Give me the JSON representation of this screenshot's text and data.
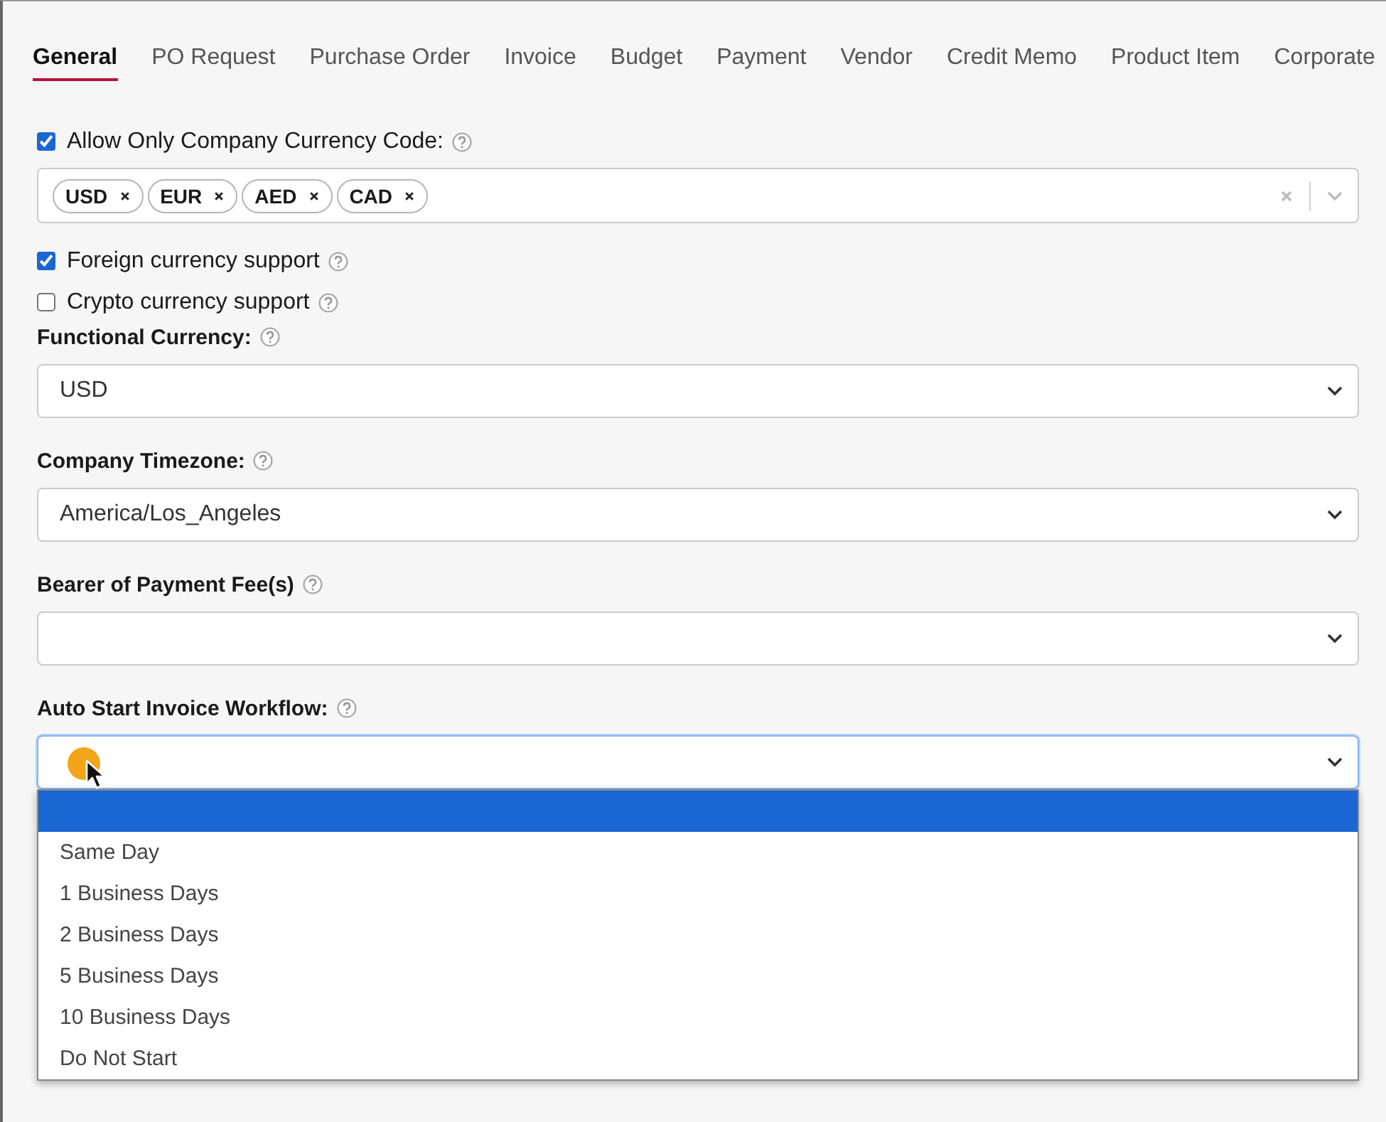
{
  "tabs": [
    {
      "label": "General",
      "selected": true
    },
    {
      "label": "PO Request",
      "selected": false
    },
    {
      "label": "Purchase Order",
      "selected": false
    },
    {
      "label": "Invoice",
      "selected": false
    },
    {
      "label": "Budget",
      "selected": false
    },
    {
      "label": "Payment",
      "selected": false
    },
    {
      "label": "Vendor",
      "selected": false
    },
    {
      "label": "Credit Memo",
      "selected": false
    },
    {
      "label": "Product Item",
      "selected": false
    },
    {
      "label": "Corporate",
      "selected": false
    }
  ],
  "fields": [
    {
      "kind": "checkbox",
      "label": "Allow Only Company Currency Code:",
      "checked": true,
      "help": true
    },
    {
      "kind": "tags",
      "tags": [
        "USD",
        "EUR",
        "AED",
        "CAD"
      ]
    },
    {
      "kind": "checkbox",
      "label": "Foreign currency support",
      "checked": true,
      "help": true
    },
    {
      "kind": "checkbox",
      "label": "Crypto currency support",
      "checked": false,
      "help": true
    },
    {
      "kind": "select",
      "label": "Functional Currency:",
      "value": "USD",
      "help": true
    },
    {
      "kind": "select",
      "label": "Company Timezone:",
      "value": "America/Los_Angeles",
      "help": true
    },
    {
      "kind": "select",
      "label": "Bearer of Payment Fee(s)",
      "help": true
    },
    {
      "kind": "select",
      "label": "Auto Start Invoice Workflow:",
      "help": true,
      "focused": true,
      "options": [
        {
          "selected": true
        },
        {
          "label": "Same Day",
          "selected": false
        },
        {
          "label": "1 Business Days",
          "selected": false
        },
        {
          "label": "2 Business Days",
          "selected": false
        },
        {
          "label": "5 Business Days",
          "selected": false
        },
        {
          "label": "10 Business Days",
          "selected": false
        },
        {
          "label": "Do Not Start",
          "selected": false
        }
      ]
    }
  ]
}
